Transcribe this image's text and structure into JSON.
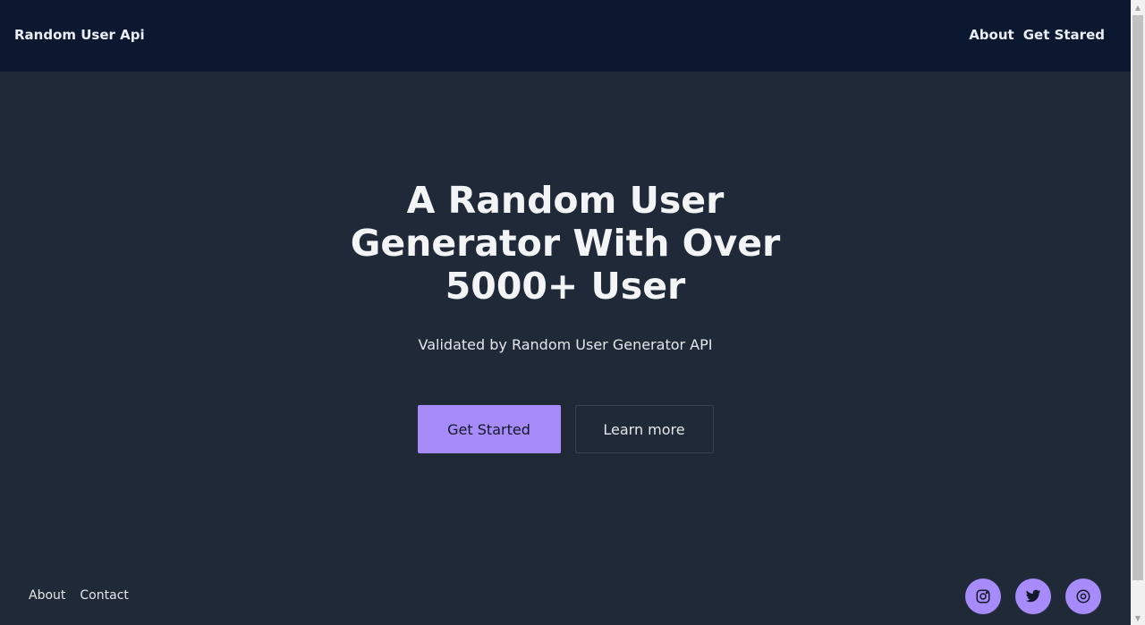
{
  "header": {
    "brand": "Random User Api",
    "nav": [
      {
        "label": "About"
      },
      {
        "label": "Get Stared"
      }
    ]
  },
  "hero": {
    "title": "A Random User Generator With Over 5000+ User",
    "subtitle": "Validated by Random User Generator API",
    "primary_button": "Get Started",
    "secondary_button": "Learn more"
  },
  "footer": {
    "links": [
      {
        "label": "About"
      },
      {
        "label": "Contact"
      }
    ],
    "social_icons": [
      "instagram-icon",
      "twitter-icon",
      "dribbble-icon"
    ]
  },
  "colors": {
    "navbar_bg": "#0c1830",
    "page_bg": "#1f2937",
    "accent": "#a78bfa",
    "text": "#f3f4f6"
  }
}
